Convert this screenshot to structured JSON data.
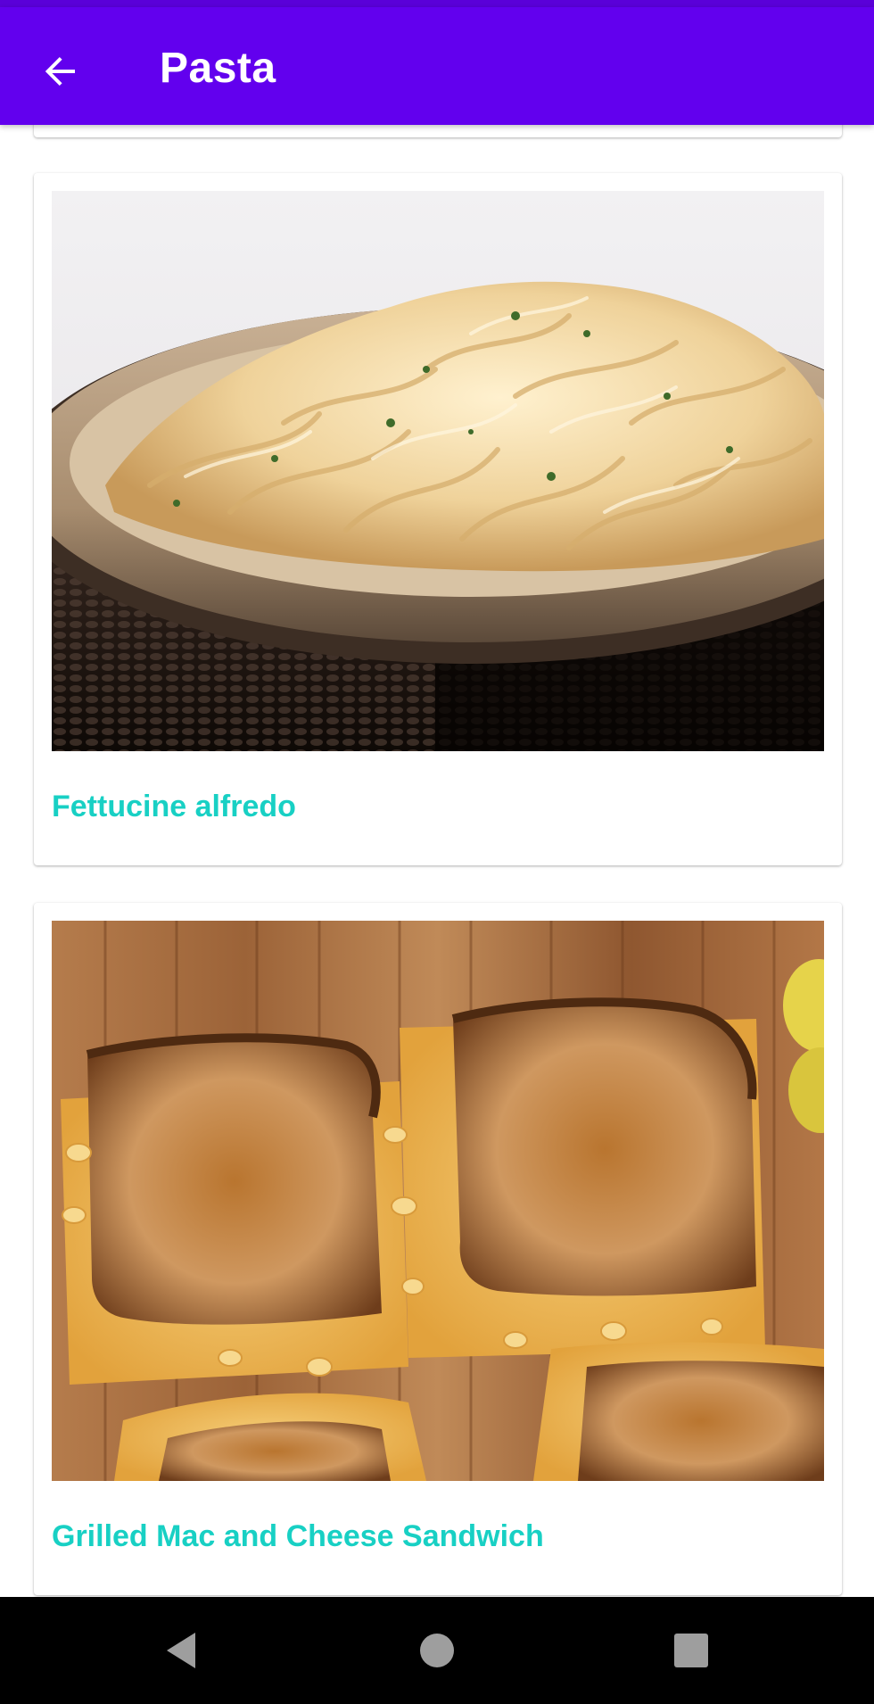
{
  "app_bar": {
    "title": "Pasta",
    "back_icon": "arrow-back-icon",
    "color": "#6200ee"
  },
  "recipes": [
    {
      "title": "Fettucine alfredo",
      "image": "fettuccine-alfredo-photo"
    },
    {
      "title": "Grilled Mac and Cheese Sandwich",
      "image": "grilled-mac-and-cheese-sandwich-photo"
    }
  ],
  "accent_color": "#18d0c4",
  "nav_bar": {
    "back_icon": "triangle-back-icon",
    "home_icon": "circle-home-icon",
    "recents_icon": "square-recents-icon"
  }
}
